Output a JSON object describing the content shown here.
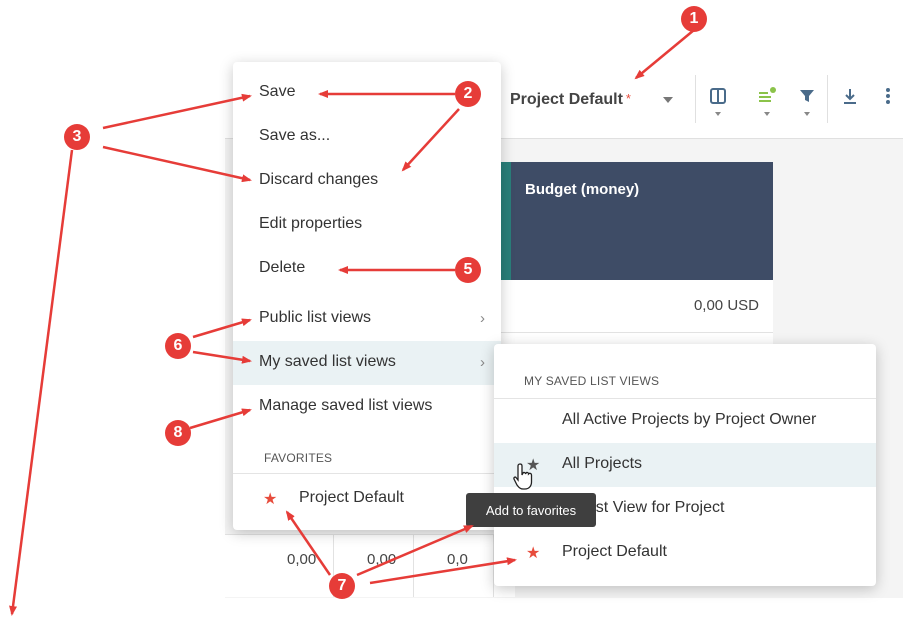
{
  "toolbar": {
    "view_name": "Project Default",
    "modified_marker": "*",
    "icons": [
      "columns-icon",
      "list-settings-icon",
      "filter-icon",
      "download-icon",
      "more-icon"
    ],
    "accent_color": "#8bc34a"
  },
  "table": {
    "column_header": "Budget (money)",
    "first_value": "0,00 USD",
    "bottom_values": [
      "0,00",
      "0,00",
      "0,0"
    ]
  },
  "menu": {
    "items": [
      {
        "label": "Save"
      },
      {
        "label": "Save as..."
      },
      {
        "label": "Discard changes"
      },
      {
        "label": "Edit properties"
      },
      {
        "label": "Delete"
      },
      {
        "label": "Public list views"
      },
      {
        "label": "My saved list views"
      },
      {
        "label": "Manage saved list views"
      }
    ],
    "favorites_header": "FAVORITES",
    "favorite_item": "Project Default"
  },
  "submenu": {
    "header": "MY SAVED LIST VIEWS",
    "items": [
      {
        "label": "All Active Projects by Project Owner"
      },
      {
        "label": "All Projects"
      },
      {
        "label": "ult List View for Project"
      },
      {
        "label": "Project Default"
      }
    ]
  },
  "tooltip": "Add to favorites",
  "callouts": [
    "1",
    "2",
    "3",
    "5",
    "6",
    "7",
    "8"
  ],
  "colors": {
    "callout": "#e63c38",
    "header_dark": "#3e4c66",
    "header_teal": "#2a7f7a",
    "highlight": "#eaf2f4",
    "star": "#e74c3c"
  }
}
